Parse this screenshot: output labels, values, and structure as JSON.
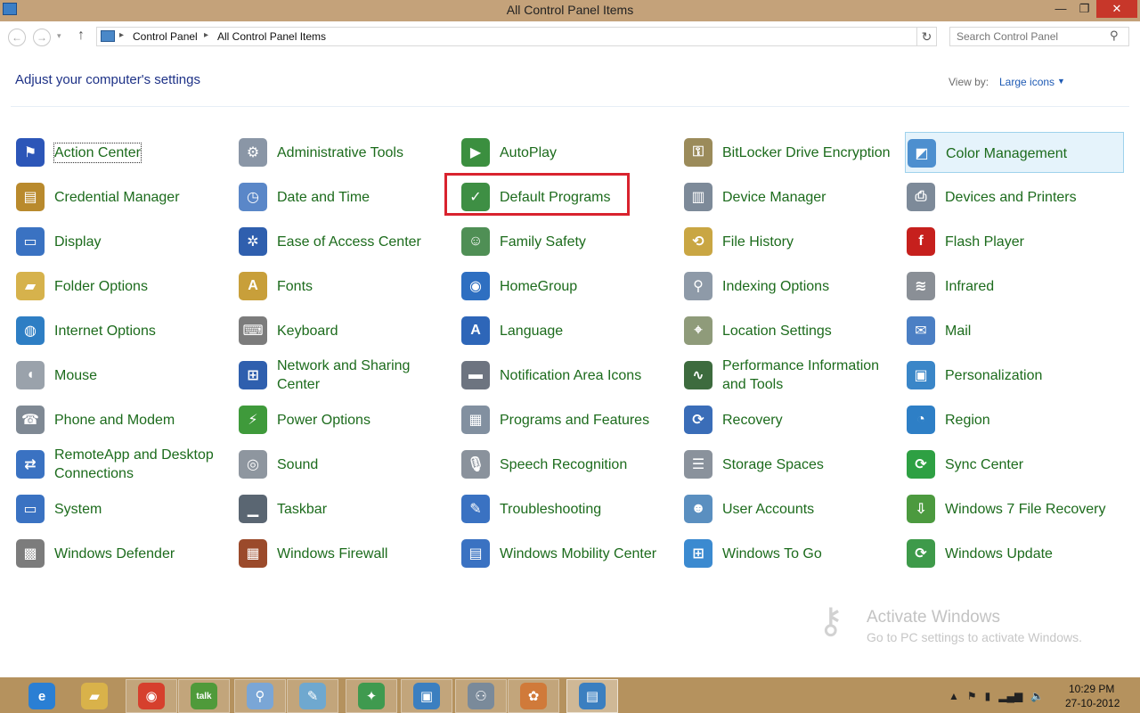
{
  "window": {
    "title": "All Control Panel Items",
    "min_glyph": "—",
    "max_glyph": "❐",
    "close_glyph": "✕"
  },
  "nav": {
    "back_glyph": "←",
    "forward_glyph": "→",
    "recent_glyph": "▾",
    "up_glyph": "↑",
    "breadcrumb": [
      "Control Panel",
      "All Control Panel Items"
    ],
    "separator": "▸",
    "dropdown_glyph": "⌄",
    "refresh_glyph": "↻",
    "search_placeholder": "Search Control Panel",
    "search_glyph": "⚲"
  },
  "header": {
    "title": "Adjust your computer's settings",
    "view_by_label": "View by:",
    "view_by_value": "Large icons",
    "view_by_arrow": "▼"
  },
  "items": [
    {
      "label": "Action Center",
      "icon": "flag-icon",
      "color": "#2c56b8",
      "glyph": "⚑"
    },
    {
      "label": "Administrative Tools",
      "icon": "admin-tools-icon",
      "color": "#8a96a6",
      "glyph": "⚙"
    },
    {
      "label": "AutoPlay",
      "icon": "autoplay-icon",
      "color": "#3b8f3f",
      "glyph": "▶"
    },
    {
      "label": "BitLocker Drive Encryption",
      "icon": "bitlocker-icon",
      "color": "#9b8b5a",
      "glyph": "⚿"
    },
    {
      "label": "Color Management",
      "icon": "color-management-icon",
      "color": "#4d8fcf",
      "glyph": "◩"
    },
    {
      "label": "Credential Manager",
      "icon": "credential-manager-icon",
      "color": "#b98a2d",
      "glyph": "▤"
    },
    {
      "label": "Date and Time",
      "icon": "date-time-icon",
      "color": "#5a87c8",
      "glyph": "◷"
    },
    {
      "label": "Default Programs",
      "icon": "default-programs-icon",
      "color": "#3e8f44",
      "glyph": "✓"
    },
    {
      "label": "Device Manager",
      "icon": "device-manager-icon",
      "color": "#7d8a99",
      "glyph": "▥"
    },
    {
      "label": "Devices and Printers",
      "icon": "printer-icon",
      "color": "#7d8a99",
      "glyph": "⎙"
    },
    {
      "label": "Display",
      "icon": "display-icon",
      "color": "#3a72c2",
      "glyph": "▭"
    },
    {
      "label": "Ease of Access Center",
      "icon": "ease-of-access-icon",
      "color": "#2f5fae",
      "glyph": "✲"
    },
    {
      "label": "Family Safety",
      "icon": "family-safety-icon",
      "color": "#4f8f55",
      "glyph": "☺"
    },
    {
      "label": "File History",
      "icon": "file-history-icon",
      "color": "#c9a643",
      "glyph": "⟲"
    },
    {
      "label": "Flash Player",
      "icon": "flash-player-icon",
      "color": "#c6201d",
      "glyph": "f"
    },
    {
      "label": "Folder Options",
      "icon": "folder-options-icon",
      "color": "#d6b24c",
      "glyph": "▰"
    },
    {
      "label": "Fonts",
      "icon": "fonts-icon",
      "color": "#c89f3a",
      "glyph": "A"
    },
    {
      "label": "HomeGroup",
      "icon": "homegroup-icon",
      "color": "#2e6fc1",
      "glyph": "◉"
    },
    {
      "label": "Indexing Options",
      "icon": "indexing-options-icon",
      "color": "#8e9aa8",
      "glyph": "⚲"
    },
    {
      "label": "Infrared",
      "icon": "infrared-icon",
      "color": "#8a8f96",
      "glyph": "≋"
    },
    {
      "label": "Internet Options",
      "icon": "internet-options-icon",
      "color": "#2e7ec4",
      "glyph": "◍"
    },
    {
      "label": "Keyboard",
      "icon": "keyboard-icon",
      "color": "#7c7c7c",
      "glyph": "⌨"
    },
    {
      "label": "Language",
      "icon": "language-icon",
      "color": "#2e66b8",
      "glyph": "A"
    },
    {
      "label": "Location Settings",
      "icon": "location-settings-icon",
      "color": "#8f9b7a",
      "glyph": "⌖"
    },
    {
      "label": "Mail",
      "icon": "mail-icon",
      "color": "#4b7fc4",
      "glyph": "✉"
    },
    {
      "label": "Mouse",
      "icon": "mouse-icon",
      "color": "#9aa2ab",
      "glyph": "◖"
    },
    {
      "label": "Network and Sharing Center",
      "icon": "network-sharing-icon",
      "color": "#2f5fae",
      "glyph": "⊞"
    },
    {
      "label": "Notification Area Icons",
      "icon": "notification-area-icon",
      "color": "#6d7480",
      "glyph": "▬"
    },
    {
      "label": "Performance Information and Tools",
      "icon": "performance-icon",
      "color": "#3d6b3e",
      "glyph": "∿"
    },
    {
      "label": "Personalization",
      "icon": "personalization-icon",
      "color": "#3a86c8",
      "glyph": "▣"
    },
    {
      "label": "Phone and Modem",
      "icon": "phone-modem-icon",
      "color": "#7f8994",
      "glyph": "☎"
    },
    {
      "label": "Power Options",
      "icon": "power-options-icon",
      "color": "#3f9a3b",
      "glyph": "⚡"
    },
    {
      "label": "Programs and Features",
      "icon": "programs-features-icon",
      "color": "#8290a0",
      "glyph": "▦"
    },
    {
      "label": "Recovery",
      "icon": "recovery-icon",
      "color": "#3a6db8",
      "glyph": "⟳"
    },
    {
      "label": "Region",
      "icon": "region-icon",
      "color": "#2e7fc6",
      "glyph": "◔"
    },
    {
      "label": "RemoteApp and Desktop Connections",
      "icon": "remoteapp-icon",
      "color": "#3a72c2",
      "glyph": "⇄"
    },
    {
      "label": "Sound",
      "icon": "sound-icon",
      "color": "#8e969f",
      "glyph": "◎"
    },
    {
      "label": "Speech Recognition",
      "icon": "speech-recognition-icon",
      "color": "#8a929c",
      "glyph": "🎙"
    },
    {
      "label": "Storage Spaces",
      "icon": "storage-spaces-icon",
      "color": "#8a929c",
      "glyph": "☰"
    },
    {
      "label": "Sync Center",
      "icon": "sync-center-icon",
      "color": "#2ea043",
      "glyph": "⟳"
    },
    {
      "label": "System",
      "icon": "system-icon",
      "color": "#3a72c2",
      "glyph": "▭"
    },
    {
      "label": "Taskbar",
      "icon": "taskbar-icon",
      "color": "#5a6672",
      "glyph": "▁"
    },
    {
      "label": "Troubleshooting",
      "icon": "troubleshooting-icon",
      "color": "#3a72c2",
      "glyph": "✎"
    },
    {
      "label": "User Accounts",
      "icon": "user-accounts-icon",
      "color": "#5a8fc0",
      "glyph": "☻"
    },
    {
      "label": "Windows 7 File Recovery",
      "icon": "file-recovery-icon",
      "color": "#4c9a3f",
      "glyph": "⇩"
    },
    {
      "label": "Windows Defender",
      "icon": "windows-defender-icon",
      "color": "#7c7c7c",
      "glyph": "▩"
    },
    {
      "label": "Windows Firewall",
      "icon": "windows-firewall-icon",
      "color": "#9b4a2b",
      "glyph": "▦"
    },
    {
      "label": "Windows Mobility Center",
      "icon": "mobility-center-icon",
      "color": "#3a72c2",
      "glyph": "▤"
    },
    {
      "label": "Windows To Go",
      "icon": "windows-to-go-icon",
      "color": "#3b8ad0",
      "glyph": "⊞"
    },
    {
      "label": "Windows Update",
      "icon": "windows-update-icon",
      "color": "#3e9a4a",
      "glyph": "⟳"
    }
  ],
  "hover_item": "Color Management",
  "focus_item": "Action Center",
  "highlighted_item": "Default Programs",
  "watermark": {
    "title": "Activate Windows",
    "subtitle": "Go to PC settings to activate Windows.",
    "glyph": "⚷"
  },
  "taskbar": {
    "apps": [
      {
        "name": "ie-icon",
        "glyph": "e",
        "color": "#2a7fd4"
      },
      {
        "name": "file-explorer-icon",
        "glyph": "▰",
        "color": "#d9b24a"
      },
      {
        "name": "chrome-icon",
        "glyph": "◉",
        "color": "#d6402d"
      },
      {
        "name": "google-talk-icon",
        "glyph": "talk",
        "color": "#4f9a3a"
      },
      {
        "name": "magnifier-icon",
        "glyph": "⚲",
        "color": "#7aa6d6"
      },
      {
        "name": "notepad-icon",
        "glyph": "✎",
        "color": "#6fa8cf"
      },
      {
        "name": "puzzle-app-icon",
        "glyph": "✦",
        "color": "#3f9a4f"
      },
      {
        "name": "photo-viewer-icon",
        "glyph": "▣",
        "color": "#3b7fc0"
      },
      {
        "name": "network-app-icon",
        "glyph": "⚇",
        "color": "#7a8a9a"
      },
      {
        "name": "paint-icon",
        "glyph": "✿",
        "color": "#d07a3a"
      },
      {
        "name": "control-panel-icon",
        "glyph": "▤",
        "color": "#3b7fc0"
      }
    ],
    "tray_glyphs": [
      "▲",
      "⚑",
      "▮",
      "▂▄▆",
      "🔈"
    ],
    "time": "10:29 PM",
    "date": "27-10-2012"
  }
}
